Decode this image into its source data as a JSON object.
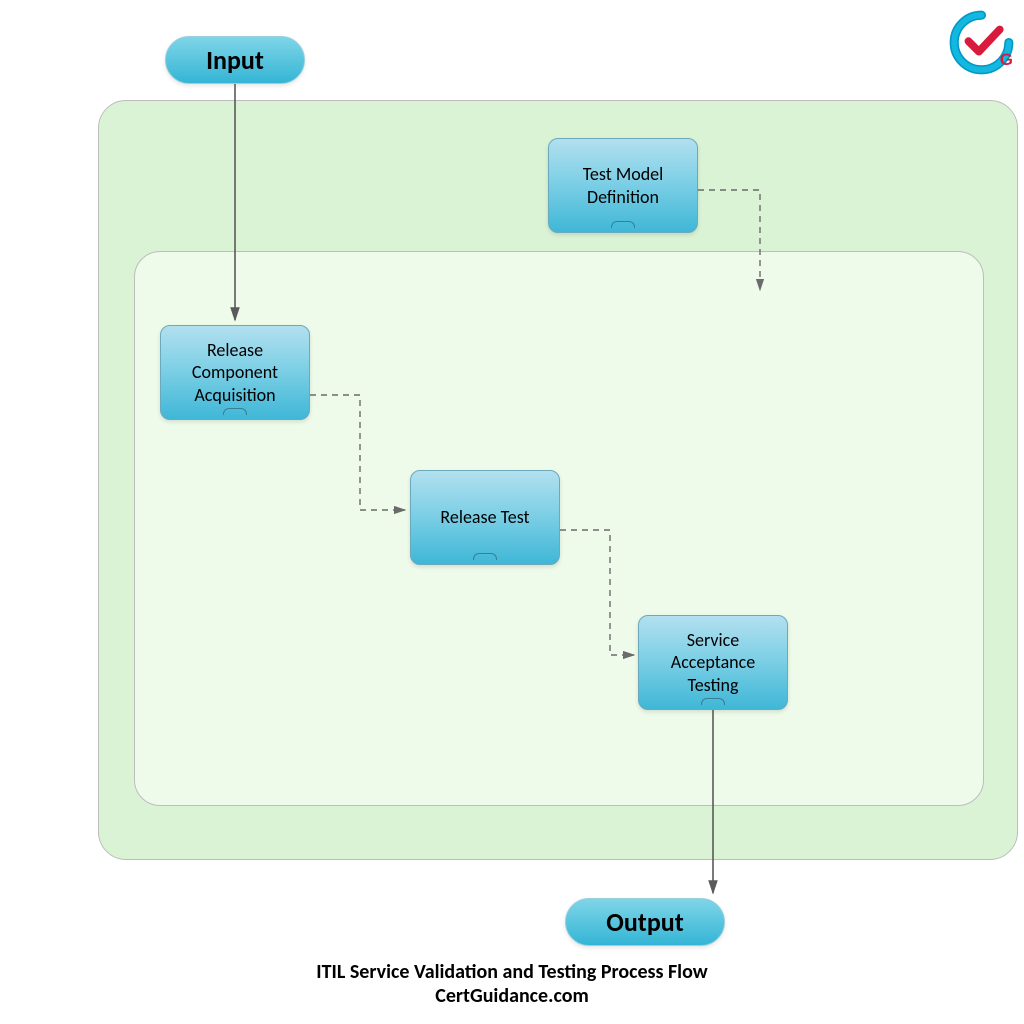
{
  "terminators": {
    "input": "Input",
    "output": "Output"
  },
  "nodes": {
    "test_model": "Test Model Definition",
    "release_component": "Release Component Acquisition",
    "release_test": "Release Test",
    "service_acceptance": "Service Acceptance Testing"
  },
  "caption": {
    "line1": "ITIL Service Validation and Testing Process Flow",
    "line2": "CertGuidance.com"
  },
  "logo_letter": "G",
  "colors": {
    "outer_bg": "#daf3d5",
    "inner_bg": "#eefbea",
    "node_top": "#b2e0ef",
    "node_bottom": "#3fb7d7",
    "terminator_top": "#7fd5e8",
    "terminator_bottom": "#34b5d5"
  }
}
